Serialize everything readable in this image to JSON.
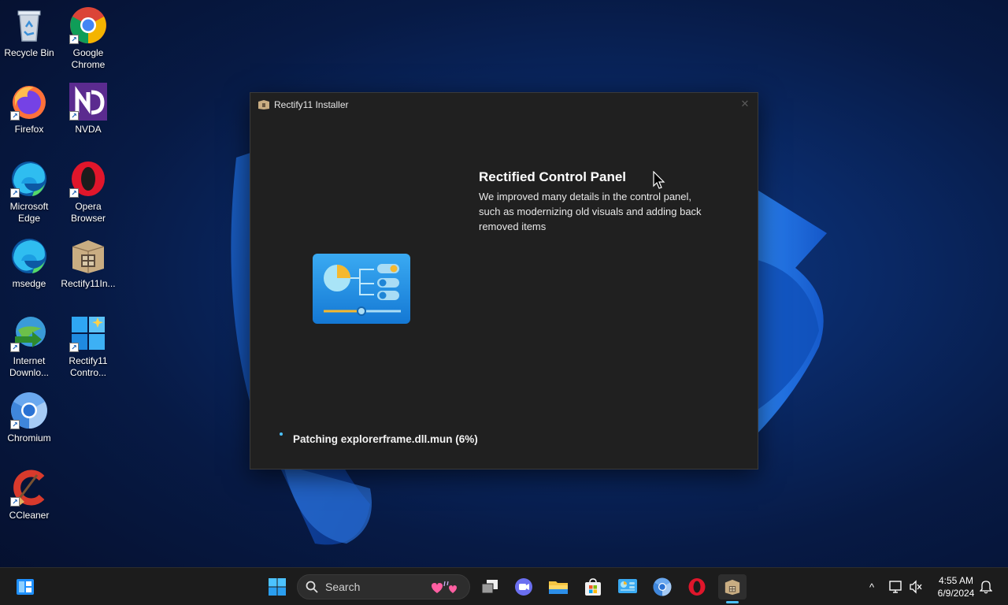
{
  "desktop": {
    "icons": [
      {
        "label": "Recycle Bin",
        "icon": "recycle-bin-icon"
      },
      {
        "label": "Google Chrome",
        "icon": "chrome-icon"
      },
      {
        "label": "Firefox",
        "icon": "firefox-icon"
      },
      {
        "label": "NVDA",
        "icon": "nvda-icon"
      },
      {
        "label": "Microsoft Edge",
        "icon": "edge-icon"
      },
      {
        "label": "Opera Browser",
        "icon": "opera-icon"
      },
      {
        "label": "msedge",
        "icon": "edge-icon"
      },
      {
        "label": "Rectify11In...",
        "icon": "installer-package-icon"
      },
      {
        "label": "Internet Downlo...",
        "icon": "internet-download-manager-icon"
      },
      {
        "label": "Rectify11 Contro...",
        "icon": "windows-tiles-icon"
      },
      {
        "label": "Chromium",
        "icon": "chromium-icon"
      },
      {
        "label": "CCleaner",
        "icon": "ccleaner-icon"
      }
    ]
  },
  "installer": {
    "title": "Rectify11 Installer",
    "close_glyph": "✕",
    "feature_title": "Rectified Control Panel",
    "feature_description": "We improved many details in the control panel, such as modernizing old visuals and adding back removed items",
    "status": "Patching explorerframe.dll.mun (6%)",
    "progress_percent": 6
  },
  "taskbar": {
    "search_label": "Search",
    "pinned": [
      "start-icon",
      "file-explorer-icon",
      "store-icon",
      "control-panel-icon",
      "chromium-icon",
      "opera-icon",
      "installer-package-icon"
    ],
    "active_app": "installer-package-icon",
    "tray": {
      "chevron": "^",
      "time": "4:55 AM",
      "date": "6/9/2024"
    }
  },
  "colors": {
    "accent": "#4cc2ff",
    "window_bg": "#202020",
    "taskbar_bg": "#1c1c1c"
  }
}
